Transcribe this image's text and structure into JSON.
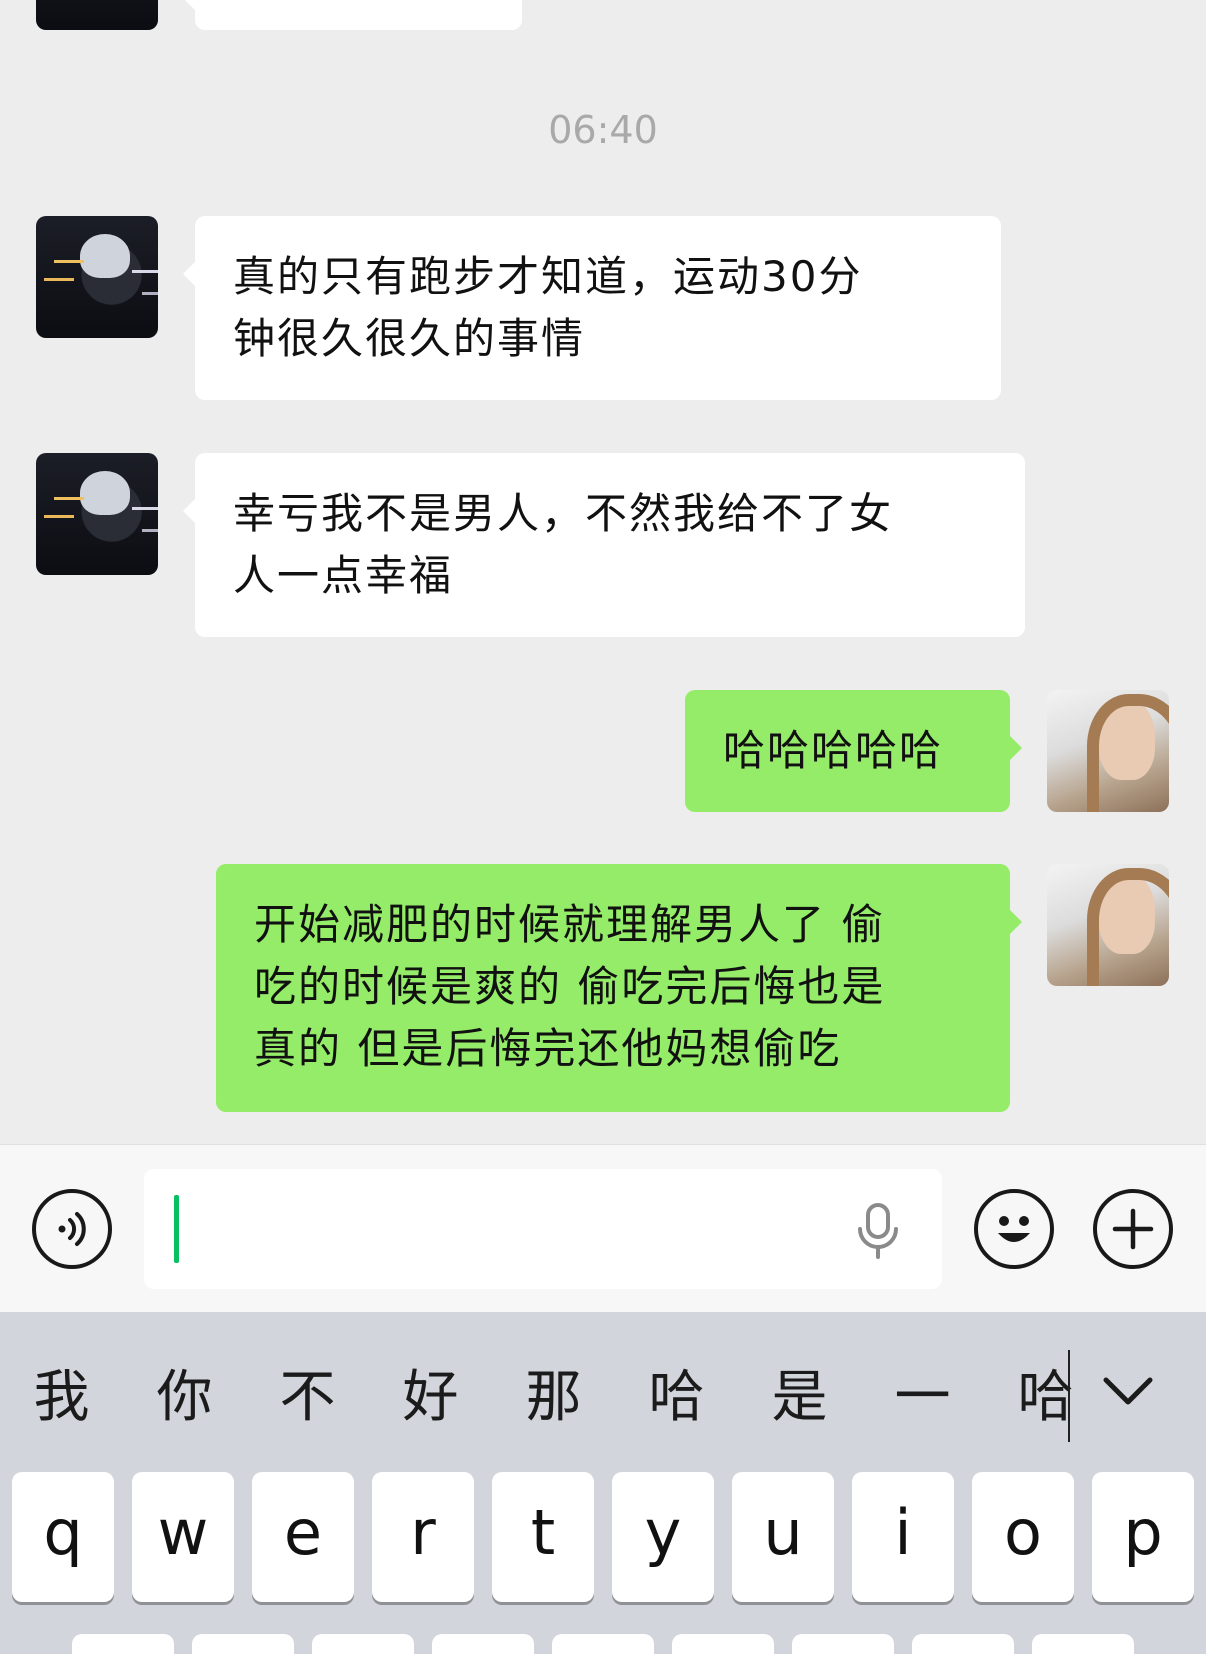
{
  "chat": {
    "timestamp": "06:40",
    "messages": [
      {
        "side": "left",
        "text": "真的只有跑步才知道，运动30分\n钟很久很久的事情"
      },
      {
        "side": "left",
        "text": "幸亏我不是男人，不然我给不了女\n人一点幸福"
      },
      {
        "side": "right",
        "text": "哈哈哈哈哈"
      },
      {
        "side": "right",
        "text": "开始减肥的时候就理解男人了 偷\n吃的时候是爽的 偷吃完后悔也是\n真的 但是后悔完还他妈想偷吃"
      }
    ]
  },
  "input_bar": {
    "text_value": "",
    "voice_icon": "voice-icon",
    "mic_icon": "microphone-icon",
    "emoji_icon": "emoji-icon",
    "plus_icon": "plus-icon"
  },
  "keyboard": {
    "candidates": [
      "我",
      "你",
      "不",
      "好",
      "那",
      "哈",
      "是",
      "一",
      "哈"
    ],
    "collapse_icon": "chevron-down-icon",
    "row1": [
      "q",
      "w",
      "e",
      "r",
      "t",
      "y",
      "u",
      "i",
      "o",
      "p"
    ]
  },
  "colors": {
    "chat_bg": "#ededed",
    "bubble_self": "#95ec69",
    "bubble_other": "#ffffff",
    "cursor": "#07c160",
    "keyboard_bg": "#d2d5db"
  }
}
